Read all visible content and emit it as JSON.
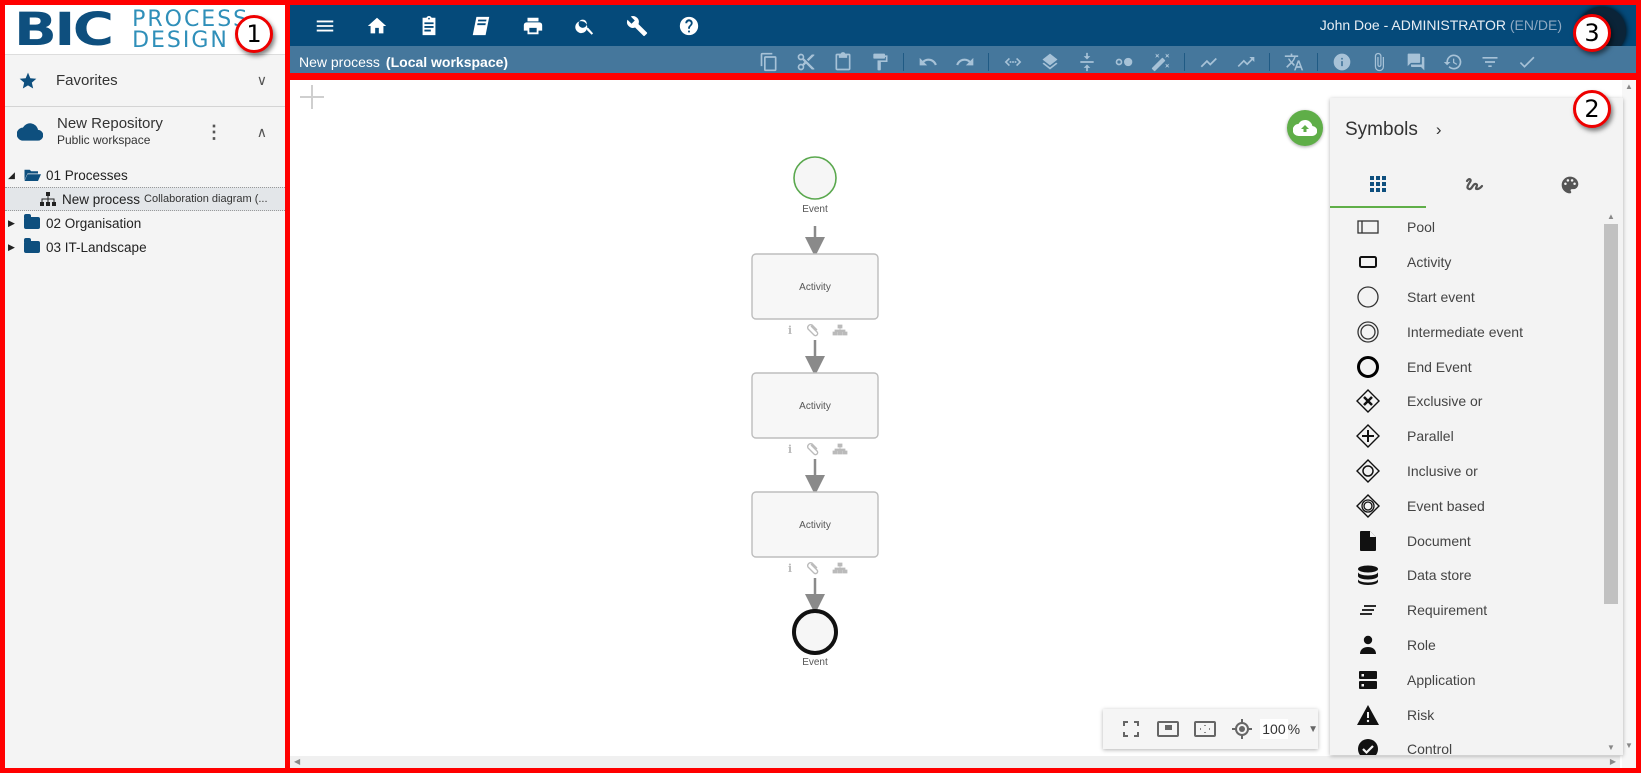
{
  "annotations": [
    "1",
    "2",
    "3"
  ],
  "logo": {
    "brand": "BIC",
    "line1": "PROCESS",
    "line2": "DESIGN"
  },
  "sidebar": {
    "favorites": {
      "label": "Favorites",
      "icon": "star-icon"
    },
    "repository": {
      "title": "New Repository",
      "subtitle": "Public workspace",
      "icon": "cloud-icon"
    },
    "tree": [
      {
        "label": "01 Processes",
        "expanded": true,
        "icon": "folder-open-icon"
      },
      {
        "label": "New process",
        "sub": "Collaboration diagram (...",
        "icon": "hierarchy-icon",
        "selected": true
      },
      {
        "label": "02 Organisation",
        "expanded": false,
        "icon": "folder-icon"
      },
      {
        "label": "03 IT-Landscape",
        "expanded": false,
        "icon": "folder-icon"
      }
    ]
  },
  "header": {
    "nav_icons": [
      "menu-icon",
      "home-icon",
      "clipboard-icon",
      "book-icon",
      "print-icon",
      "search-icon",
      "wrench-icon",
      "help-icon"
    ],
    "user": "John Doe - ADMINISTRATOR",
    "language": "(EN/DE)",
    "document_title": "New process",
    "workspace": "(Local workspace)",
    "toolbar_groups": [
      [
        "copy-icon",
        "cut-icon",
        "paste-icon",
        "format-paint-icon"
      ],
      [
        "undo-icon",
        "redo-icon"
      ],
      [
        "connect-icon",
        "layers-icon",
        "compress-icon",
        "toggle-dots-icon",
        "magic-wand-icon"
      ],
      [
        "timeline-icon",
        "trending-icon"
      ],
      [
        "translate-icon"
      ],
      [
        "info-icon",
        "attachment-icon",
        "comments-icon",
        "history-icon",
        "filter-icon",
        "check-icon"
      ]
    ]
  },
  "diagram": {
    "start_event_label": "Event",
    "activities": [
      "Activity",
      "Activity",
      "Activity"
    ],
    "end_event_label": "Event",
    "colors": {
      "start": "#5aa84e",
      "end": "#111111",
      "arrow": "#8a8a8a"
    }
  },
  "symbols_panel": {
    "title": "Symbols",
    "tabs": [
      "grid-icon",
      "freehand-icon",
      "palette-icon"
    ],
    "active_tab": 0,
    "items": [
      {
        "label": "Pool",
        "icon": "pool-icon"
      },
      {
        "label": "Activity",
        "icon": "activity-icon"
      },
      {
        "label": "Start event",
        "icon": "start-event-icon"
      },
      {
        "label": "Intermediate event",
        "icon": "intermediate-event-icon"
      },
      {
        "label": "End Event",
        "icon": "end-event-icon"
      },
      {
        "label": "Exclusive or",
        "icon": "exclusive-gateway-icon"
      },
      {
        "label": "Parallel",
        "icon": "parallel-gateway-icon"
      },
      {
        "label": "Inclusive or",
        "icon": "inclusive-gateway-icon"
      },
      {
        "label": "Event based",
        "icon": "event-gateway-icon"
      },
      {
        "label": "Document",
        "icon": "document-icon"
      },
      {
        "label": "Data store",
        "icon": "data-store-icon"
      },
      {
        "label": "Requirement",
        "icon": "requirement-icon"
      },
      {
        "label": "Role",
        "icon": "role-icon"
      },
      {
        "label": "Application",
        "icon": "application-icon"
      },
      {
        "label": "Risk",
        "icon": "risk-icon"
      },
      {
        "label": "Control",
        "icon": "control-icon"
      }
    ]
  },
  "zoom_controls": {
    "value": "100",
    "unit": "%"
  },
  "colors": {
    "header_dark": "#054a7a",
    "header_sub": "#45779c",
    "accent_green": "#5fae48"
  }
}
